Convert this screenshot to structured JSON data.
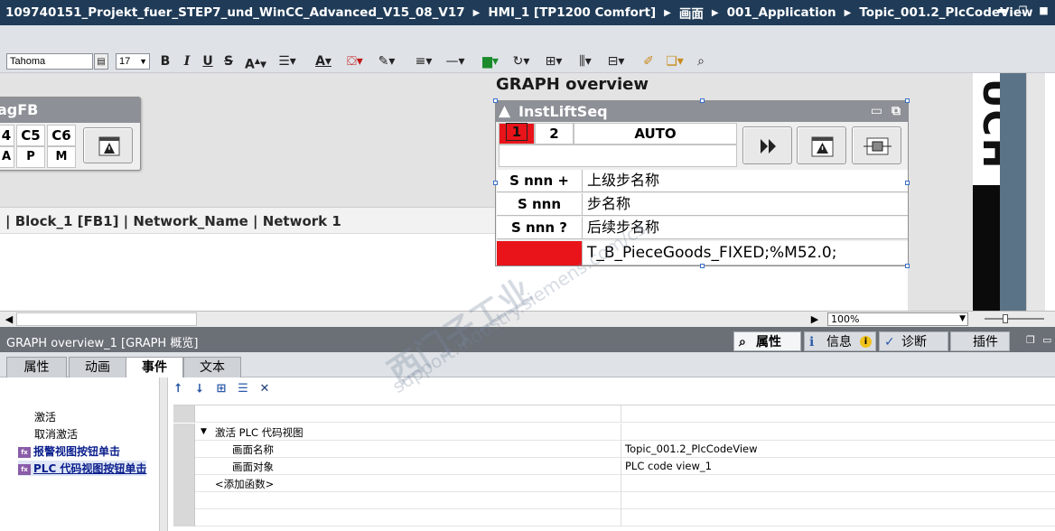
{
  "breadcrumb": [
    "109740151_Projekt_fuer_STEP7_und_WinCC_Advanced_V15_08_V17",
    "HMI_1 [TP1200 Comfort]",
    "画面",
    "001_Application",
    "Topic_001.2_PlcCodeView"
  ],
  "toolbar": {
    "font_name": "Tahoma",
    "font_size": "17"
  },
  "canvas": {
    "graph_overview_title": "GRAPH overview",
    "fb_block": {
      "title": "agFB",
      "cells_top": [
        "4",
        "C5",
        "C6"
      ],
      "cells_bottom": [
        "A",
        "P",
        "M"
      ]
    },
    "network_text": "| Block_1 [FB1] | Network_Name | Network 1",
    "graph_block": {
      "title": "InstLiftSeq",
      "step_cell": "1",
      "cell_2": "2",
      "mode": "AUTO",
      "rows": [
        {
          "label": "S nnn +",
          "text": "上级步名称"
        },
        {
          "label": "S nnn",
          "text": "步名称"
        },
        {
          "label": "S nnn ?",
          "text": "后续步名称"
        },
        {
          "label": "",
          "text": "T_B_PieceGoods_FIXED;%M52.0;"
        }
      ]
    },
    "touch_text": "UCH"
  },
  "zoom": "100%",
  "inspector": {
    "title": "GRAPH overview_1 [GRAPH 概览]",
    "tabs": [
      "属性",
      "信息",
      "诊断",
      "插件"
    ],
    "prop_tabs": [
      "属性",
      "动画",
      "事件",
      "文本"
    ],
    "events": [
      "激活",
      "取消激活",
      "报警视图按钮单击",
      "PLC 代码视图按钮单击"
    ],
    "function_rows": [
      {
        "name": "激活 PLC 代码视图",
        "value": ""
      },
      {
        "name": "画面名称",
        "value": "Topic_001.2_PlcCodeView"
      },
      {
        "name": "画面对象",
        "value": "PLC code view_1"
      },
      {
        "name": "<添加函数>",
        "value": ""
      }
    ]
  },
  "watermark": [
    "西门子工业",
    "support.industry.siemens.com/cs"
  ]
}
